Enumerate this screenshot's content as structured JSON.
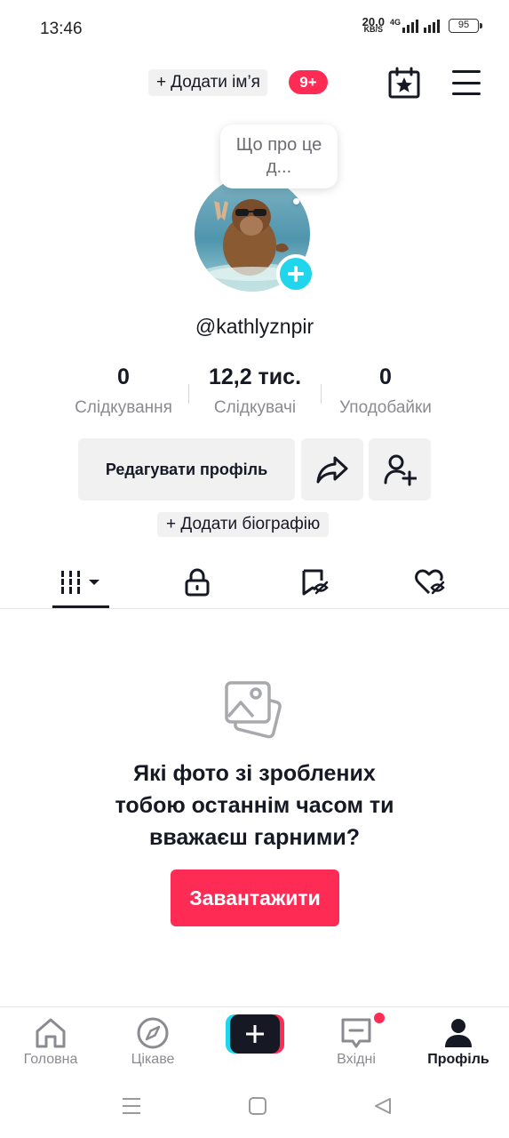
{
  "status_bar": {
    "time": "13:46",
    "net_speed": "20,0",
    "net_unit": "KB/S",
    "net_type": "4G",
    "battery": "95"
  },
  "top_bar": {
    "add_name_plus": "+",
    "add_name_label": "Додати ім’я",
    "notification_badge": "9+",
    "calendar_icon": "calendar-star-icon",
    "menu_icon": "hamburger-menu-icon"
  },
  "profile": {
    "bubble_text": "Що про це д...",
    "username": "@kathlyznpir",
    "stats": [
      {
        "value": "0",
        "label": "Слідкування"
      },
      {
        "value": "12,2 тис.",
        "label": "Слідкувачі"
      },
      {
        "value": "0",
        "label": "Уподобайки"
      }
    ],
    "edit_label": "Редагувати профіль",
    "add_bio_label": "+ Додати біографію"
  },
  "tabs": [
    {
      "icon": "videos-grid-icon",
      "active": true
    },
    {
      "icon": "lock-icon",
      "active": false
    },
    {
      "icon": "bookmark-hidden-icon",
      "active": false
    },
    {
      "icon": "heart-hidden-icon",
      "active": false
    }
  ],
  "empty_state": {
    "icon": "photos-icon",
    "line1": "Які фото зі зроблених",
    "line2": "тобою останнім часом ти",
    "line3": "вважаєш гарними?",
    "upload_label": "Завантажити"
  },
  "bottom_nav": {
    "home": "Головна",
    "discover": "Цікаве",
    "inbox": "Вхідні",
    "profile": "Профіль"
  },
  "colors": {
    "accent_red": "#fe2c55",
    "accent_cyan": "#20d5ec",
    "text_primary": "#161823",
    "text_secondary": "#8a8b91",
    "button_bg": "#f1f1f2"
  }
}
